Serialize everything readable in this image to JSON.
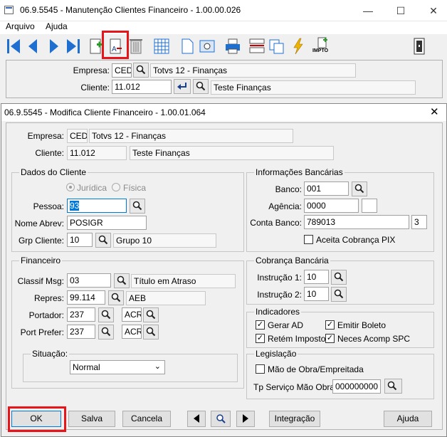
{
  "window": {
    "title": "06.9.5545 - Manutenção Clientes Financeiro - 1.00.00.026"
  },
  "menu": [
    "Arquivo",
    "Ajuda"
  ],
  "main": {
    "empresa_label": "Empresa:",
    "empresa_code": "CED",
    "empresa_name": "Totvs 12 - Finanças",
    "cliente_label": "Cliente:",
    "cliente_code": "11.012",
    "cliente_name": "Teste Finanças",
    "toolbar_impto": "IMPTO"
  },
  "dialog": {
    "title": "06.9.5545 - Modifica Cliente Financeiro - 1.00.01.064",
    "empresa_label": "Empresa:",
    "empresa_code": "CED",
    "empresa_name": "Totvs 12 - Finanças",
    "cliente_label": "Cliente:",
    "cliente_code": "11.012",
    "cliente_name": "Teste Finanças",
    "dados": {
      "title": "Dados do Cliente",
      "juridica": "Jurídica",
      "fisica": "Física",
      "pessoa_label": "Pessoa:",
      "pessoa": "93",
      "abrev_label": "Nome Abrev:",
      "abrev": "POSIGR",
      "grp_label": "Grp Cliente:",
      "grp_code": "10",
      "grp_name": "Grupo 10"
    },
    "financeiro": {
      "title": "Financeiro",
      "classif_label": "Classif Msg:",
      "classif_code": "03",
      "classif_name": "Título em Atraso",
      "repres_label": "Repres:",
      "repres_code": "99.114",
      "repres_name": "AEB",
      "portador_label": "Portador:",
      "portador_code": "237",
      "portador_mod": "ACR",
      "portpref_label": "Port Prefer:",
      "portpref_code": "237",
      "portpref_mod": "ACR",
      "situacao_label": "Situação:",
      "situacao": "Normal"
    },
    "bancarias": {
      "title": "Informações Bancárias",
      "banco_label": "Banco:",
      "banco": "001",
      "agencia_label": "Agência:",
      "agencia": "0000",
      "agencia_dv": "",
      "conta_label": "Conta Banco:",
      "conta": "789013",
      "conta_dv": "3",
      "pix_label": "Aceita Cobrança PIX"
    },
    "cobranca": {
      "title": "Cobrança Bancária",
      "instr1_label": "Instrução 1:",
      "instr1": "10",
      "instr2_label": "Instrução 2:",
      "instr2": "10"
    },
    "indicadores": {
      "title": "Indicadores",
      "gerar_ad": "Gerar AD",
      "emitir_boleto": "Emitir Boleto",
      "retem": "Retém Imposto",
      "neces": "Neces Acomp SPC"
    },
    "legislacao": {
      "title": "Legislação",
      "mao_obra": "Mão de Obra/Empreitada",
      "tp_label": "Tp Serviço Mão Obra:",
      "tp": "000000000"
    },
    "buttons": {
      "ok": "OK",
      "salva": "Salva",
      "cancela": "Cancela",
      "integracao": "Integração",
      "ajuda": "Ajuda"
    }
  },
  "colors": {
    "highlight": "#e8141a",
    "selection": "#0078d7"
  }
}
